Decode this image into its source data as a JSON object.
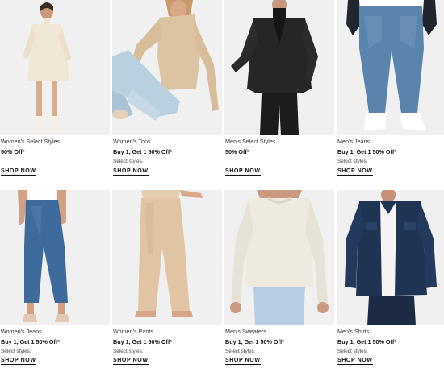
{
  "products": [
    {
      "title": "Women's Select Styles",
      "offer": "50% Off*",
      "note": "",
      "cta": "SHOP NOW",
      "image": "women-sweater-dress"
    },
    {
      "title": "Women's Tops",
      "offer": "Buy 1, Get 1 50% Off*",
      "note": "Select styles.",
      "cta": "SHOP NOW",
      "image": "women-knit-top"
    },
    {
      "title": "Men's Select Styles",
      "offer": "50% Off*",
      "note": "",
      "cta": "SHOP NOW",
      "image": "men-suit"
    },
    {
      "title": "Men's Jeans",
      "offer": "Buy 1, Get 1 50% Off*",
      "note": "Select styles.",
      "cta": "SHOP NOW",
      "image": "men-jeans"
    },
    {
      "title": "Women's Jeans",
      "offer": "Buy 1, Get 1 50% Off*",
      "note": "Select styles.",
      "cta": "SHOP NOW",
      "image": "women-jeans"
    },
    {
      "title": "Women's Pants",
      "offer": "Buy 1, Get 1 50% Off*",
      "note": "Select styles.",
      "cta": "SHOP NOW",
      "image": "women-pants"
    },
    {
      "title": "Men's Sweaters",
      "offer": "Buy 1, Get 1 50% Off*",
      "note": "Select styles.",
      "cta": "SHOP NOW",
      "image": "men-sweater"
    },
    {
      "title": "Men's Shirts",
      "offer": "Buy 1, Get 1 50% Off*",
      "note": "Select styles.",
      "cta": "SHOP NOW",
      "image": "men-shirt"
    }
  ],
  "colors": {
    "background": "#ffffff",
    "photo_bg": "#f1f1f1",
    "text": "#111111"
  }
}
